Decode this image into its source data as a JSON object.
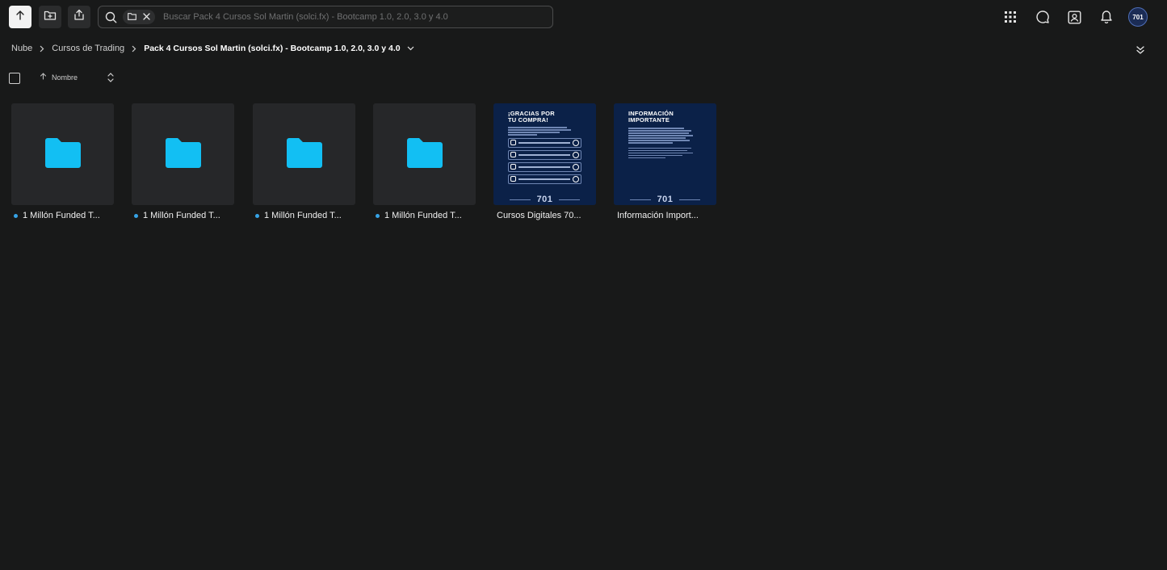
{
  "toolbar": {
    "upload_icon": "arrow-up-icon",
    "new_folder_icon": "folder-plus-icon",
    "share_icon": "share-icon"
  },
  "search": {
    "placeholder": "Buscar Pack 4 Cursos Sol Martin (solci.fx) - Bootcamp 1.0, 2.0, 3.0 y 4.0",
    "value": ""
  },
  "header_right": {
    "icons": [
      "apps-grid-icon",
      "chat-icon",
      "contacts-icon",
      "bell-icon"
    ],
    "avatar_text": "701"
  },
  "breadcrumb": {
    "items": [
      "Nube",
      "Cursos de Trading"
    ],
    "current": "Pack 4 Cursos Sol Martin (solci.fx) - Bootcamp 1.0, 2.0, 3.0 y 4.0"
  },
  "sort": {
    "label": "Nombre"
  },
  "files": [
    {
      "name": "1 Millón Funded T...",
      "type": "folder"
    },
    {
      "name": "1 Millón Funded T...",
      "type": "folder"
    },
    {
      "name": "1 Millón Funded T...",
      "type": "folder"
    },
    {
      "name": "1 Millón Funded T...",
      "type": "folder"
    },
    {
      "name": "Cursos Digitales 70...",
      "type": "image",
      "poster_title_1": "¡GRACIAS POR",
      "poster_title_2": "TU COMPRA!",
      "logo": "701"
    },
    {
      "name": "Información Import...",
      "type": "image",
      "poster_title_1": "INFORMACIÓN",
      "poster_title_2": "IMPORTANTE",
      "logo": "701"
    }
  ],
  "colors": {
    "background": "#181919",
    "folder": "#12bff3",
    "dot": "#36a3e6",
    "poster_bg": "#0b2148"
  }
}
